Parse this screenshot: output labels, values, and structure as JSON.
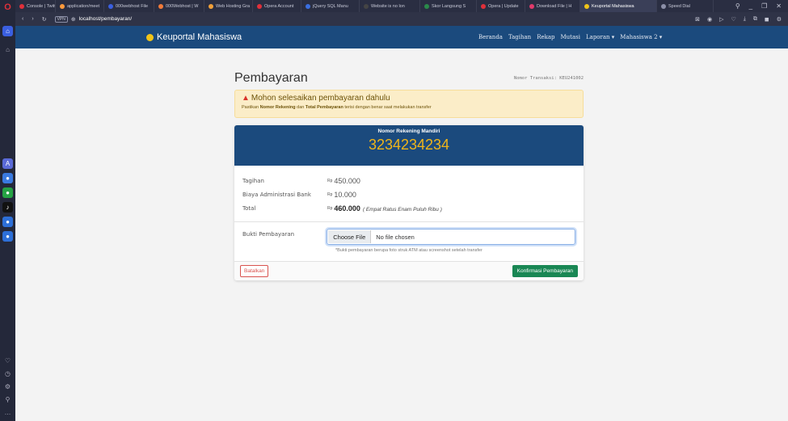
{
  "browser": {
    "tabs": [
      {
        "label": "Console | Twitter",
        "color": "#e0303a"
      },
      {
        "label": "application/meet",
        "color": "#ff9a3c"
      },
      {
        "label": "000webhost File",
        "color": "#3a5fe0"
      },
      {
        "label": "000Webhost | W",
        "color": "#f07a3a"
      },
      {
        "label": "Web Hosting Gra",
        "color": "#f0a03a"
      },
      {
        "label": "Opera Account",
        "color": "#e0303a"
      },
      {
        "label": "jQuery SQL Manu",
        "color": "#3a6fe0"
      },
      {
        "label": "Website is no lon",
        "color": "#444444"
      },
      {
        "label": "Skor Langsung S",
        "color": "#2a8a4a"
      },
      {
        "label": "Opera | Update",
        "color": "#e0303a"
      },
      {
        "label": "Download File | H",
        "color": "#e03a6a"
      },
      {
        "label": "Keuportal Mahasiswa",
        "color": "#f0c419"
      },
      {
        "label": "Speed Dial",
        "color": "#8c90a8"
      }
    ],
    "active_tab_index": 11,
    "vpn_label": "VPN",
    "url": "localhost/pembayaran/"
  },
  "navbar": {
    "brand": "Keuportal Mahasiswa",
    "menu": [
      "Beranda",
      "Tagihan",
      "Rekap",
      "Mutasi",
      "Laporan ▾",
      "Mahasiswa 2 ▾"
    ]
  },
  "page": {
    "title": "Pembayaran",
    "transaction": "Nomor Transaksi: KEU241002"
  },
  "alert": {
    "title": "Mohon selesaikan pembayaran dahulu",
    "text_pre": "Pastikan ",
    "text_bold1": "Nomor Rekening",
    "text_mid": " dan ",
    "text_bold2": "Total Pembayaran",
    "text_post": " terisi dengan benar saat melakukan transfer"
  },
  "card": {
    "account_label": "Nomor Rekening Mandiri",
    "account_number": "3234234234",
    "rows": [
      {
        "label": "Tagihan",
        "currency": "Rp",
        "value": "450.000"
      },
      {
        "label": "Biaya Administrasi Bank",
        "currency": "Rp",
        "value": "10.000"
      },
      {
        "label": "Total",
        "currency": "Rp",
        "value": "460.000",
        "words": "( Empat Ratus Enam Puluh Ribu )"
      }
    ],
    "upload_label": "Bukti Pembayaran",
    "file_button": "Choose File",
    "file_status": "No file chosen",
    "hint": "*Bukti pembayaran berupa foto struk ATM atau screenshot setelah transfer",
    "cancel_label": "Batalkan",
    "confirm_label": "Konfirmasi Pembayaran"
  },
  "colors": {
    "navbar": "#1b4a7d",
    "account_number": "#f0b519",
    "confirm": "#198754",
    "cancel": "#d9534f",
    "alert_bg": "#fbedc8"
  }
}
